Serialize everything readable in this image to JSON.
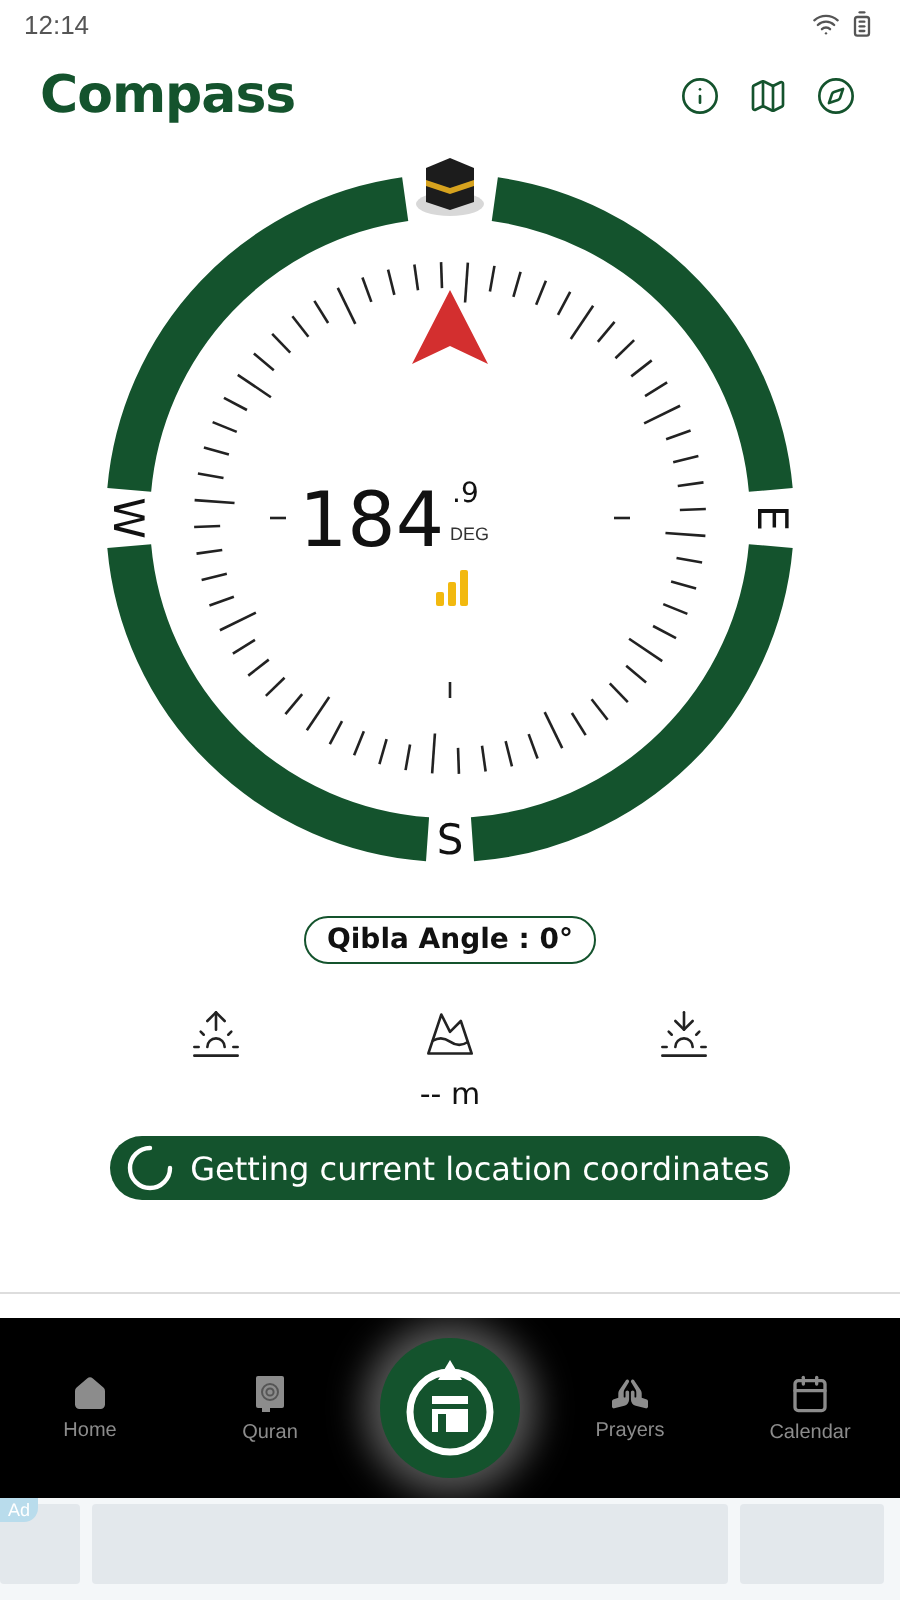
{
  "status_bar": {
    "time": "12:14"
  },
  "header": {
    "title": "Compass",
    "actions": [
      {
        "kind": "info"
      },
      {
        "kind": "map"
      },
      {
        "kind": "compass"
      }
    ]
  },
  "compass": {
    "directions": [
      {
        "kind": "west",
        "label": "W"
      },
      {
        "kind": "east",
        "label": "E"
      },
      {
        "kind": "south",
        "label": "S"
      }
    ],
    "heading": "184",
    "heading_fraction": ".9",
    "unit": "DEG"
  },
  "qibla": {
    "label": "Qibla Angle : 0°"
  },
  "sun": {
    "altitude": "-- m"
  },
  "location_status": {
    "text": "Getting current location coordinates"
  },
  "nav": [
    {
      "kind": "home",
      "label": "Home",
      "selected": false
    },
    {
      "kind": "quran",
      "label": "Quran",
      "selected": false
    },
    {
      "kind": "qibla",
      "selected": true
    },
    {
      "kind": "prayers",
      "label": "Prayers",
      "selected": false
    },
    {
      "kind": "calendar",
      "label": "Calendar",
      "selected": false
    }
  ],
  "ad": {
    "badge": "Ad"
  }
}
